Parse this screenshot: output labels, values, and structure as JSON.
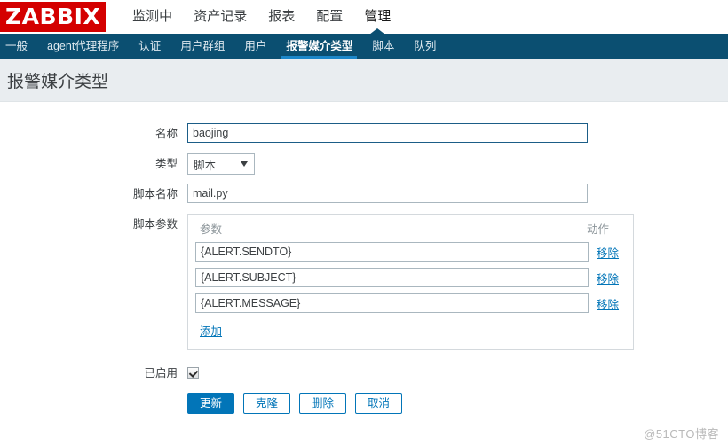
{
  "brand": {
    "logo_text": "ZABBIX",
    "logo_bg": "#d40000",
    "accent": "#0275b8",
    "nav_bg": "#0b4f71"
  },
  "top_menu": {
    "items": [
      {
        "label": "监测中",
        "selected": false
      },
      {
        "label": "资产记录",
        "selected": false
      },
      {
        "label": "报表",
        "selected": false
      },
      {
        "label": "配置",
        "selected": false
      },
      {
        "label": "管理",
        "selected": true
      }
    ]
  },
  "sub_nav": {
    "items": [
      {
        "label": "一般",
        "active": false
      },
      {
        "label": "agent代理程序",
        "active": false
      },
      {
        "label": "认证",
        "active": false
      },
      {
        "label": "用户群组",
        "active": false
      },
      {
        "label": "用户",
        "active": false
      },
      {
        "label": "报警媒介类型",
        "active": true
      },
      {
        "label": "脚本",
        "active": false
      },
      {
        "label": "队列",
        "active": false
      }
    ]
  },
  "page": {
    "title": "报警媒介类型"
  },
  "form": {
    "name": {
      "label": "名称",
      "value": "baojing",
      "placeholder": ""
    },
    "type": {
      "label": "类型",
      "value": "脚本",
      "options": [
        "脚本"
      ]
    },
    "script_name": {
      "label": "脚本名称",
      "value": "mail.py",
      "placeholder": ""
    },
    "script_params": {
      "label": "脚本参数",
      "columns": {
        "parameter": "参数",
        "action": "动作"
      },
      "rows": [
        {
          "value": "{ALERT.SENDTO}",
          "action": "移除"
        },
        {
          "value": "{ALERT.SUBJECT}",
          "action": "移除"
        },
        {
          "value": "{ALERT.MESSAGE}",
          "action": "移除"
        }
      ],
      "add_label": "添加"
    },
    "enabled": {
      "label": "已启用",
      "checked": true
    }
  },
  "buttons": [
    {
      "label": "更新",
      "primary": true
    },
    {
      "label": "克隆",
      "primary": false
    },
    {
      "label": "删除",
      "primary": false
    },
    {
      "label": "取消",
      "primary": false
    }
  ],
  "watermark": {
    "text": "@51CTO博客"
  }
}
